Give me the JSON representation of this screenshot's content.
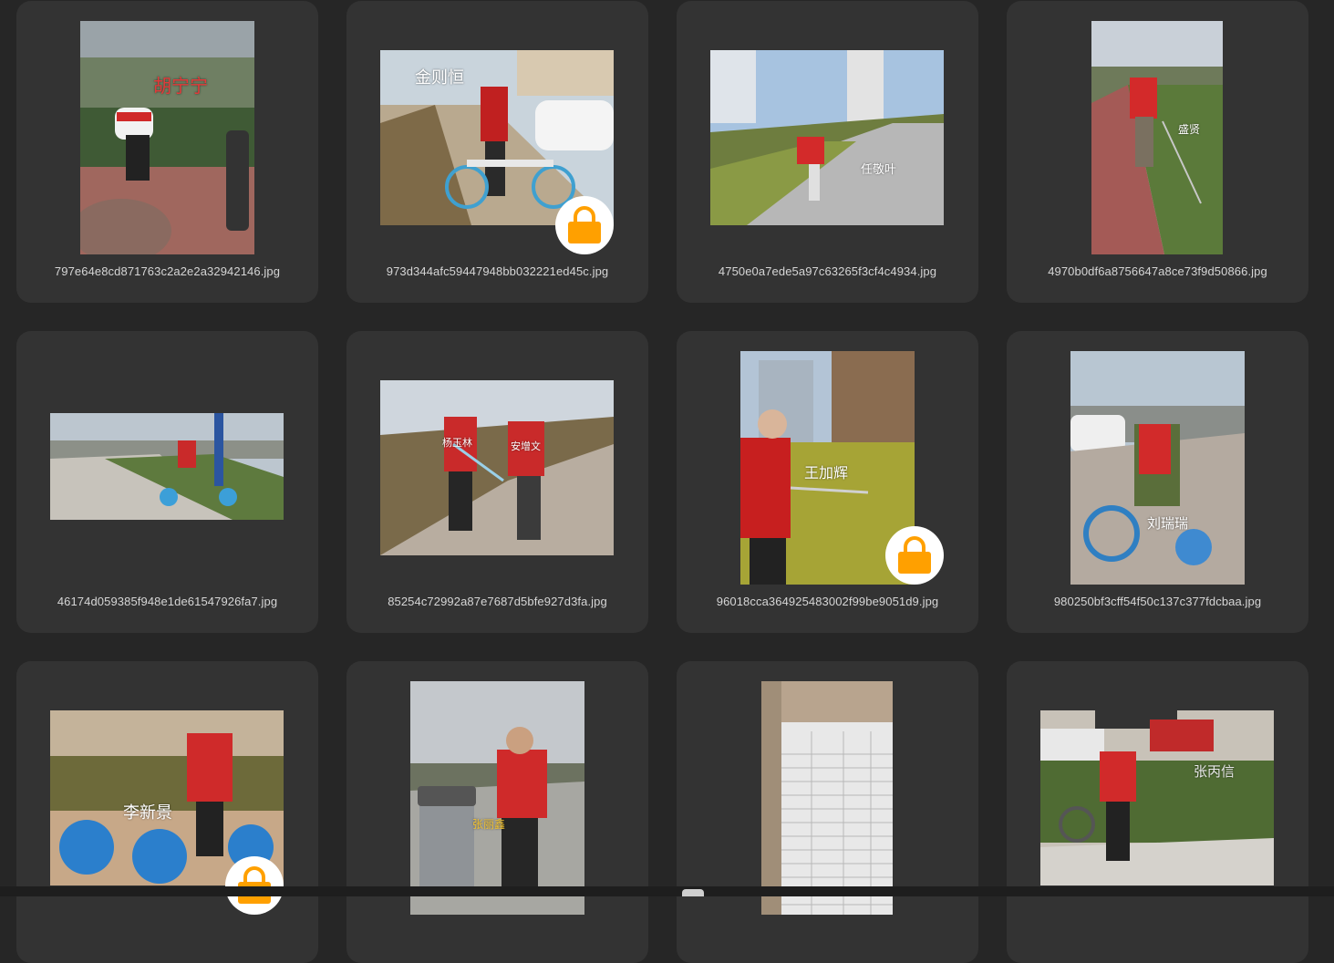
{
  "tiles": [
    {
      "filename": "797e64e8cd871763c2a2e2a32942146.jpg",
      "tag": "胡宁宁",
      "locked": false
    },
    {
      "filename": "973d344afc59447948bb032221ed45c.jpg",
      "tag": "金则恒",
      "locked": true
    },
    {
      "filename": "4750e0a7ede5a97c63265f3cf4c4934.jpg",
      "tag": "任敬叶",
      "locked": false
    },
    {
      "filename": "4970b0df6a8756647a8ce73f9d50866.jpg",
      "tag": "盛贤",
      "locked": false
    },
    {
      "filename": "46174d059385f948e1de61547926fa7.jpg",
      "tag": "",
      "locked": false
    },
    {
      "filename": "85254c72992a87e7687d5bfe927d3fa.jpg",
      "tag": "杨玉林",
      "tag2": "安增文",
      "locked": false
    },
    {
      "filename": "96018cca364925483002f99be9051d9.jpg",
      "tag": "王加辉",
      "locked": true
    },
    {
      "filename": "980250bf3cff54f50c137c377fdcbaa.jpg",
      "tag": "刘瑞瑞",
      "locked": false
    },
    {
      "filename": "",
      "tag": "李新景",
      "locked": true
    },
    {
      "filename": "",
      "tag": "张丽鑫",
      "locked": false
    },
    {
      "filename": "",
      "tag": "",
      "locked": false
    },
    {
      "filename": "",
      "tag": "张丙信",
      "locked": false
    }
  ],
  "colors": {
    "background": "#262626",
    "tile": "#333333",
    "lock": "#ffa000"
  },
  "icons": {
    "lock": "lock-icon"
  }
}
